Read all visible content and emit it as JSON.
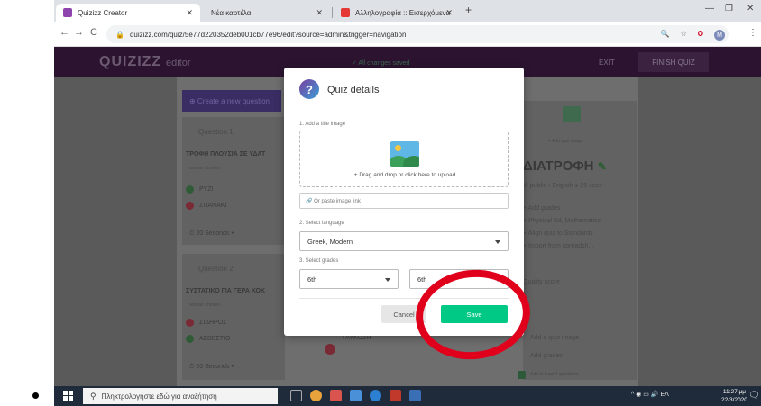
{
  "browser": {
    "tabs": [
      {
        "title": "Quizizz Creator",
        "active": true
      },
      {
        "title": "Νέα καρτέλα",
        "active": false
      },
      {
        "title": "Αλληλογραφία :: Εισερχόμενα",
        "active": false
      }
    ],
    "new_tab_glyph": "+",
    "url": "quizizz.com/quiz/5e77d220352deb001cb77e96/edit?source=admin&trigger=navigation",
    "profile_initial": "M"
  },
  "app": {
    "logo": "QUIZIZZ",
    "logo_suffix": "editor",
    "saved_status": "✓ All changes saved",
    "exit_label": "EXIT",
    "finish_label": "FINISH QUIZ",
    "create_label": "⊕ Create a new question"
  },
  "questions": [
    {
      "heading": "Question 1",
      "text": "ΤΡΟΦΗ ΠΛΟΥΣΙΑ ΣΕ ΥΔΑΤ",
      "choices_label": "answer choices",
      "answers": [
        {
          "text": "ΡΥΖΙ",
          "correct": true
        },
        {
          "text": "ΣΠΑΝΑΚΙ",
          "correct": false
        }
      ],
      "timer": "⏱ 20 Seconds ▾"
    },
    {
      "heading": "Question 2",
      "text": "ΣΥΣΤΑΤΙΚΟ ΓΙΑ ΓΕΡΑ ΚΟΚ",
      "choices_label": "answer choices",
      "answers": [
        {
          "text": "ΣΙΔΗΡΟΣ",
          "correct": false
        },
        {
          "text": "ΑΣΒΕΣΤΙΟ",
          "correct": true
        }
      ],
      "timer": "⏱ 20 Seconds ▾"
    }
  ],
  "middle_answer": "ΓΛΥΚΟΖΗ",
  "right_panel": {
    "add_image": "+ Add quiz image",
    "title": "ΔΙΑΤΡΟΦΗ",
    "meta": "⊕ public  ▪ English  ● 20 secs",
    "links": [
      "+ Add grades",
      "+ Physical Ed, Mathematics",
      "+ Align quiz to Standards",
      "+ Import from spreadsh..."
    ],
    "quality": "Quality score",
    "checklist": [
      "Add a quiz image",
      "Add grades",
      "Add at least 4 questions"
    ]
  },
  "modal": {
    "title": "Quiz details",
    "title_image_label": "1. Add a title image",
    "upload_text": "+ Drag and drop or click here to upload",
    "link_placeholder": "🔗  Or paste image link",
    "language_label": "2. Select language",
    "language_value": "Greek, Modern",
    "grades_label": "3. Select grades",
    "grade_from": "6th",
    "grade_to": "6th",
    "cancel_label": "Cancel",
    "save_label": "Save",
    "save_color": "#00c985"
  },
  "annotation": {
    "ring_color": "#e0001b"
  },
  "taskbar": {
    "search_placeholder": "Πληκτρολογήστε εδώ για αναζήτηση",
    "tray_text": "^  ◉  ▭  🔊  ΕΛ",
    "time": "11:27 μμ",
    "date": "22/3/2020"
  }
}
